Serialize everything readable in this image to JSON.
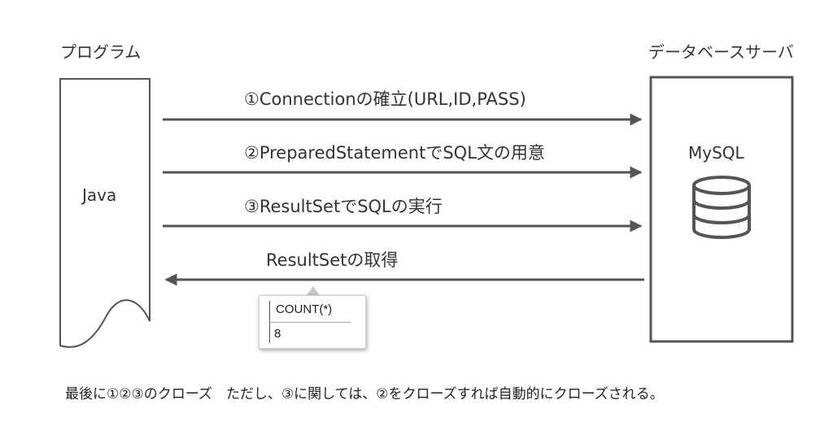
{
  "program_label": "プログラム",
  "server_label": "データベースサーバ",
  "java_label": "Java",
  "mysql_label": "MySQL",
  "arrows": [
    {
      "label": "①Connectionの確立(URL,ID,PASS)"
    },
    {
      "label": "②PreparedStatementでSQL文の用意"
    },
    {
      "label": "③ResultSetでSQLの実行"
    },
    {
      "label": "ResultSetの取得"
    }
  ],
  "result_table": {
    "header": "COUNT(*)",
    "value": "8"
  },
  "footer_note": "最後に①②③のクローズ　ただし、③に関しては、②をクローズすれば自動的にクローズされる。",
  "colors": {
    "line": "#555555",
    "text": "#333333"
  }
}
